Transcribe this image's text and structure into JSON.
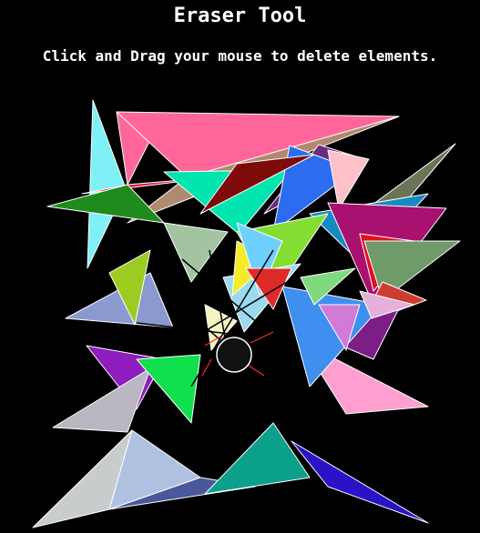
{
  "header": {
    "title": "Eraser Tool",
    "instructions": "Click and Drag your mouse to delete elements."
  },
  "canvas": {
    "background": "#000000",
    "stroke_color": "#ffffff",
    "eraser_color": "#111111",
    "hit_line_color": "#ff2a2a",
    "shape_colors": [
      "#ff6699",
      "#7ff0f5",
      "#b08a6e",
      "#6a7558",
      "#e9104a",
      "#1f8b1c",
      "#00e5b0",
      "#6b2d7e",
      "#2b6cf0",
      "#7f0a0a",
      "#ffc0c8",
      "#168ac0",
      "#a8116f",
      "#e0101f",
      "#6f9a6a",
      "#cc3c2f",
      "#8a9ad0",
      "#9ccc22",
      "#8f1cbf",
      "#b8b7c2",
      "#c9cccc",
      "#b0c0e0",
      "#48589a",
      "#0aa08a",
      "#2a12c8",
      "#ff9fd0",
      "#7c1e86",
      "#84dd33",
      "#10e04c",
      "#3f8ff0",
      "#9ad9ee",
      "#f5eb2a",
      "#f4f4c0",
      "#6fd0ff",
      "#df2a2a",
      "#a3c4a0",
      "#d17ad6",
      "#e5b0da",
      "#7fd97f"
    ]
  }
}
